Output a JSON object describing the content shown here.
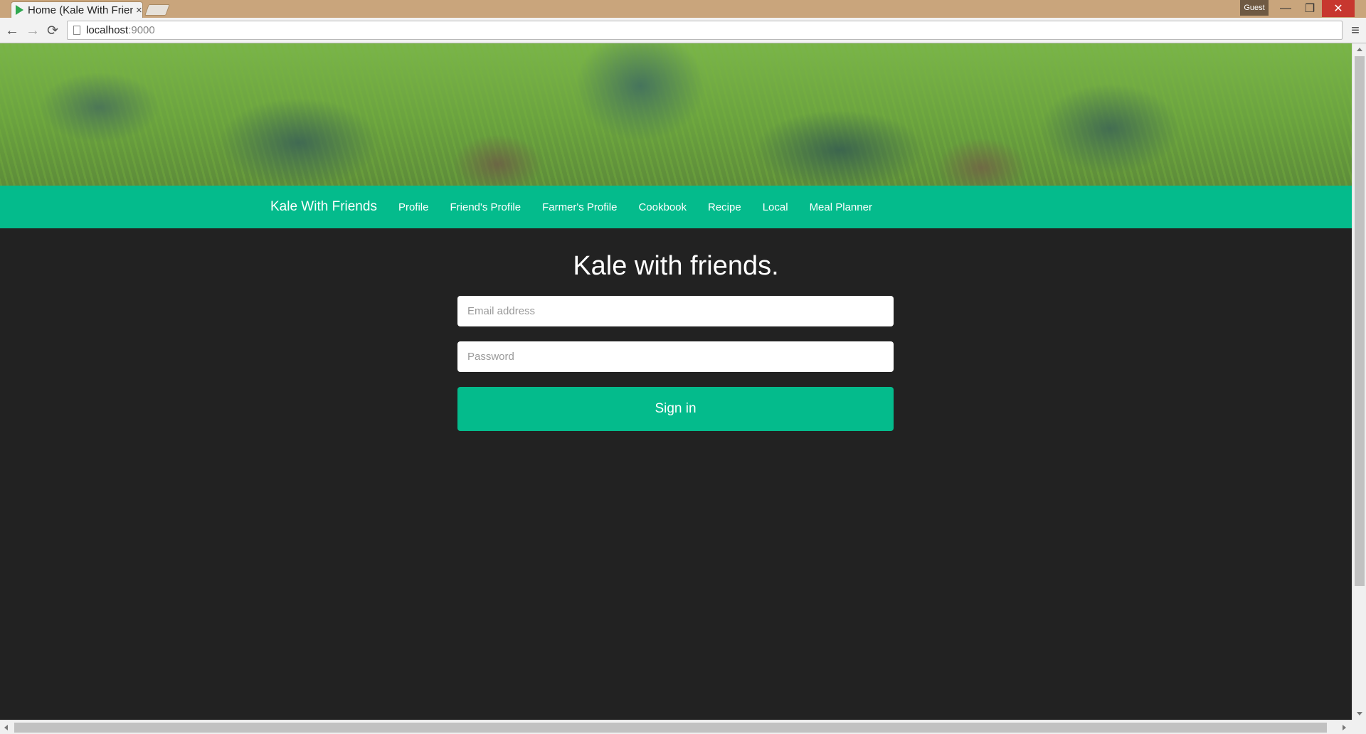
{
  "browser": {
    "tab_title": "Home (Kale With Friends)",
    "tab_close": "×",
    "profile_label": "Guest",
    "url_host": "localhost",
    "url_port": ":9000",
    "back_icon": "←",
    "forward_icon": "→",
    "reload_icon": "⟳",
    "menu_icon": "≡",
    "minimize_icon": "—",
    "maximize_icon": "❐",
    "close_icon": "✕"
  },
  "navbar": {
    "brand": "Kale With Friends",
    "links": [
      "Profile",
      "Friend's Profile",
      "Farmer's Profile",
      "Cookbook",
      "Recipe",
      "Local",
      "Meal Planner"
    ]
  },
  "main": {
    "headline": "Kale with friends.",
    "email_placeholder": "Email address",
    "password_placeholder": "Password",
    "signin_label": "Sign in"
  },
  "colors": {
    "accent": "#04bb8c",
    "background": "#222222",
    "titlebar": "#c9a57c"
  }
}
